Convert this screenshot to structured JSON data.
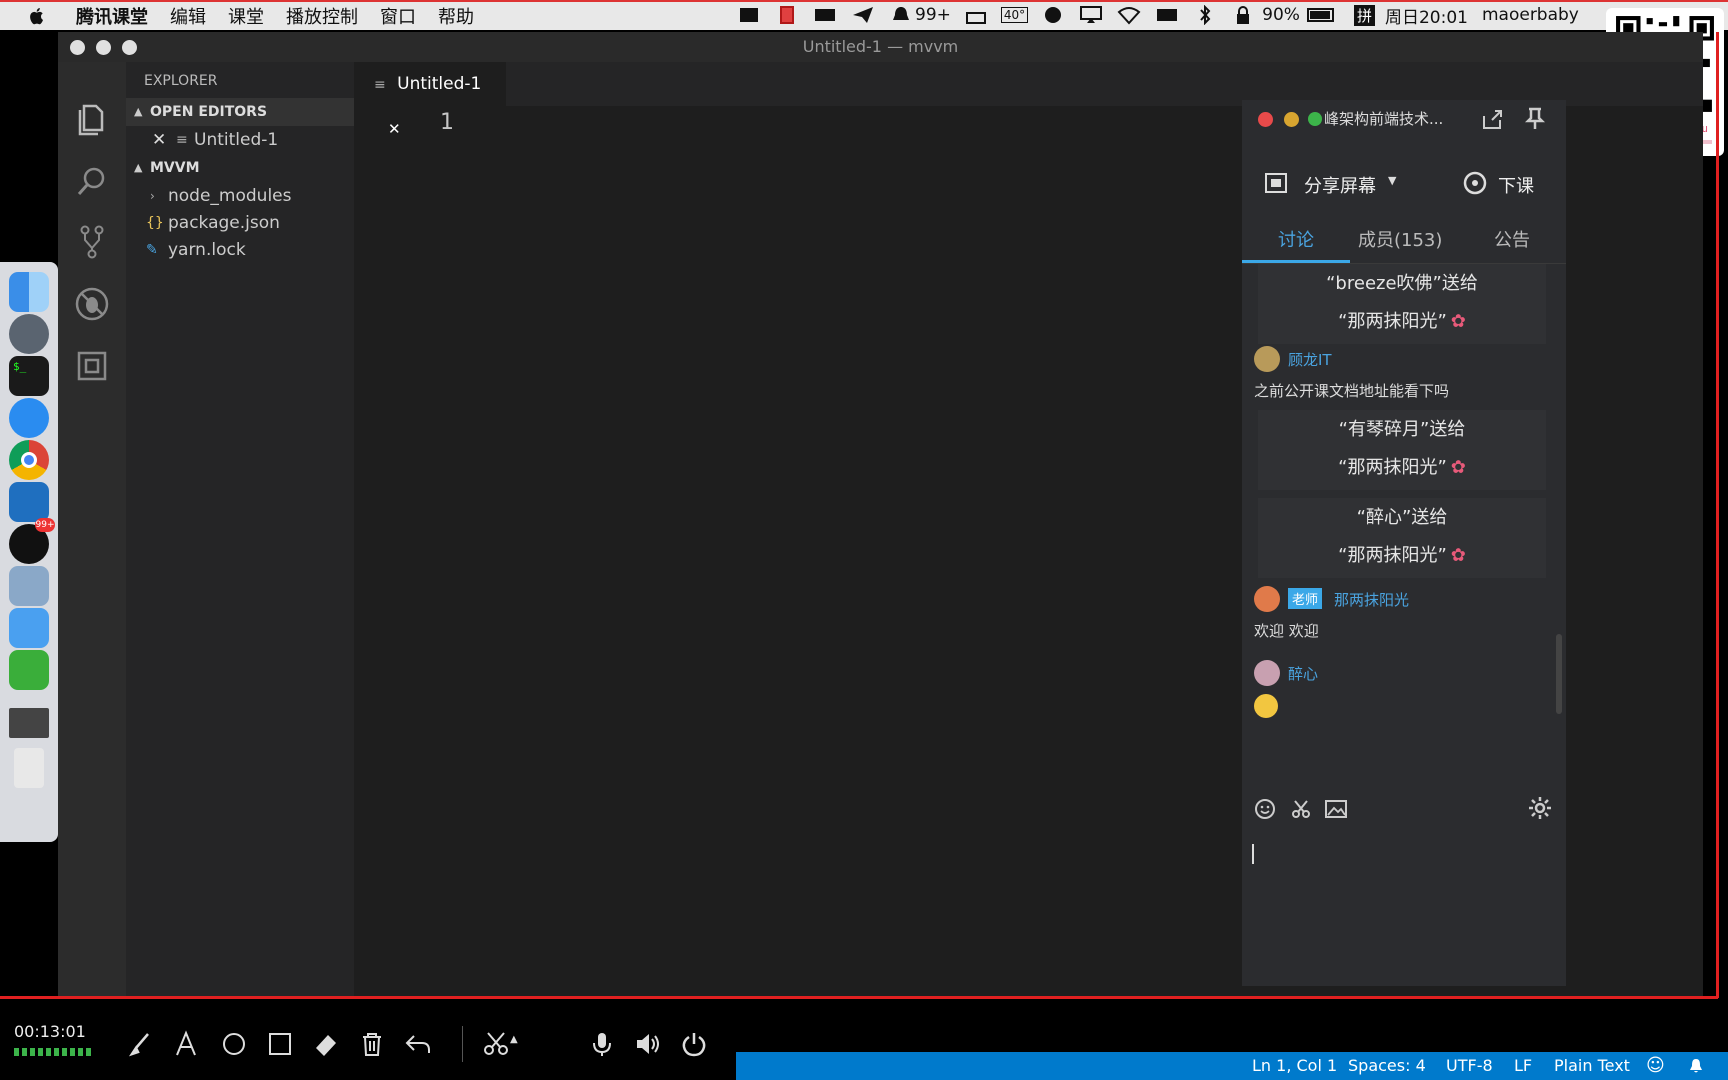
{
  "menubar": {
    "app": "腾讯课堂",
    "items": [
      "编辑",
      "课堂",
      "播放控制",
      "窗口",
      "帮助"
    ],
    "notif_count": "99+",
    "cpu_temp": "40°",
    "battery": "90%",
    "input_method": "拼",
    "clock": "周日20:01",
    "user": "maoerbaby"
  },
  "window": {
    "title": "Untitled-1 — mvvm"
  },
  "explorer": {
    "title": "EXPLORER",
    "open_editors": "OPEN EDITORS",
    "open_file": "Untitled-1",
    "project": "MVVM",
    "files": [
      "node_modules",
      "package.json",
      "yarn.lock"
    ]
  },
  "editor": {
    "tab": "Untitled-1",
    "line_number": "1"
  },
  "qq": {
    "group_name": "峰架构前端技术...",
    "share_screen": "分享屏幕",
    "end_class": "下课",
    "tabs": [
      "讨论",
      "成员(153)",
      "公告"
    ],
    "messages": [
      {
        "type": "gift",
        "line1": "“breeze吹佛”送给",
        "line2": "“那两抹阳光”"
      },
      {
        "type": "chat",
        "user": "顾龙IT",
        "text": "之前公开课文档地址能看下吗"
      },
      {
        "type": "gift",
        "line1": "“有琴碎月”送给",
        "line2": "“那两抹阳光”"
      },
      {
        "type": "gift",
        "line1": "“醉心”送给",
        "line2": "“那两抹阳光”"
      },
      {
        "type": "chat",
        "badge": "老师",
        "user": "那两抹阳光",
        "text": "欢迎 欢迎"
      },
      {
        "type": "chat",
        "user": "醉心",
        "text": ""
      }
    ]
  },
  "recorder": {
    "time": "00:13:01"
  },
  "statusbar": {
    "position": "Ln 1, Col 1",
    "spaces": "Spaces: 4",
    "encoding": "UTF-8",
    "eol": "LF",
    "language": "Plain Text"
  },
  "qr": {
    "caption": "zhufengjiagou"
  },
  "colors": {
    "accent": "#007acc",
    "chat_link": "#4aa3df",
    "tab_underline": "#3ba8e8",
    "record_red": "#e02020"
  }
}
